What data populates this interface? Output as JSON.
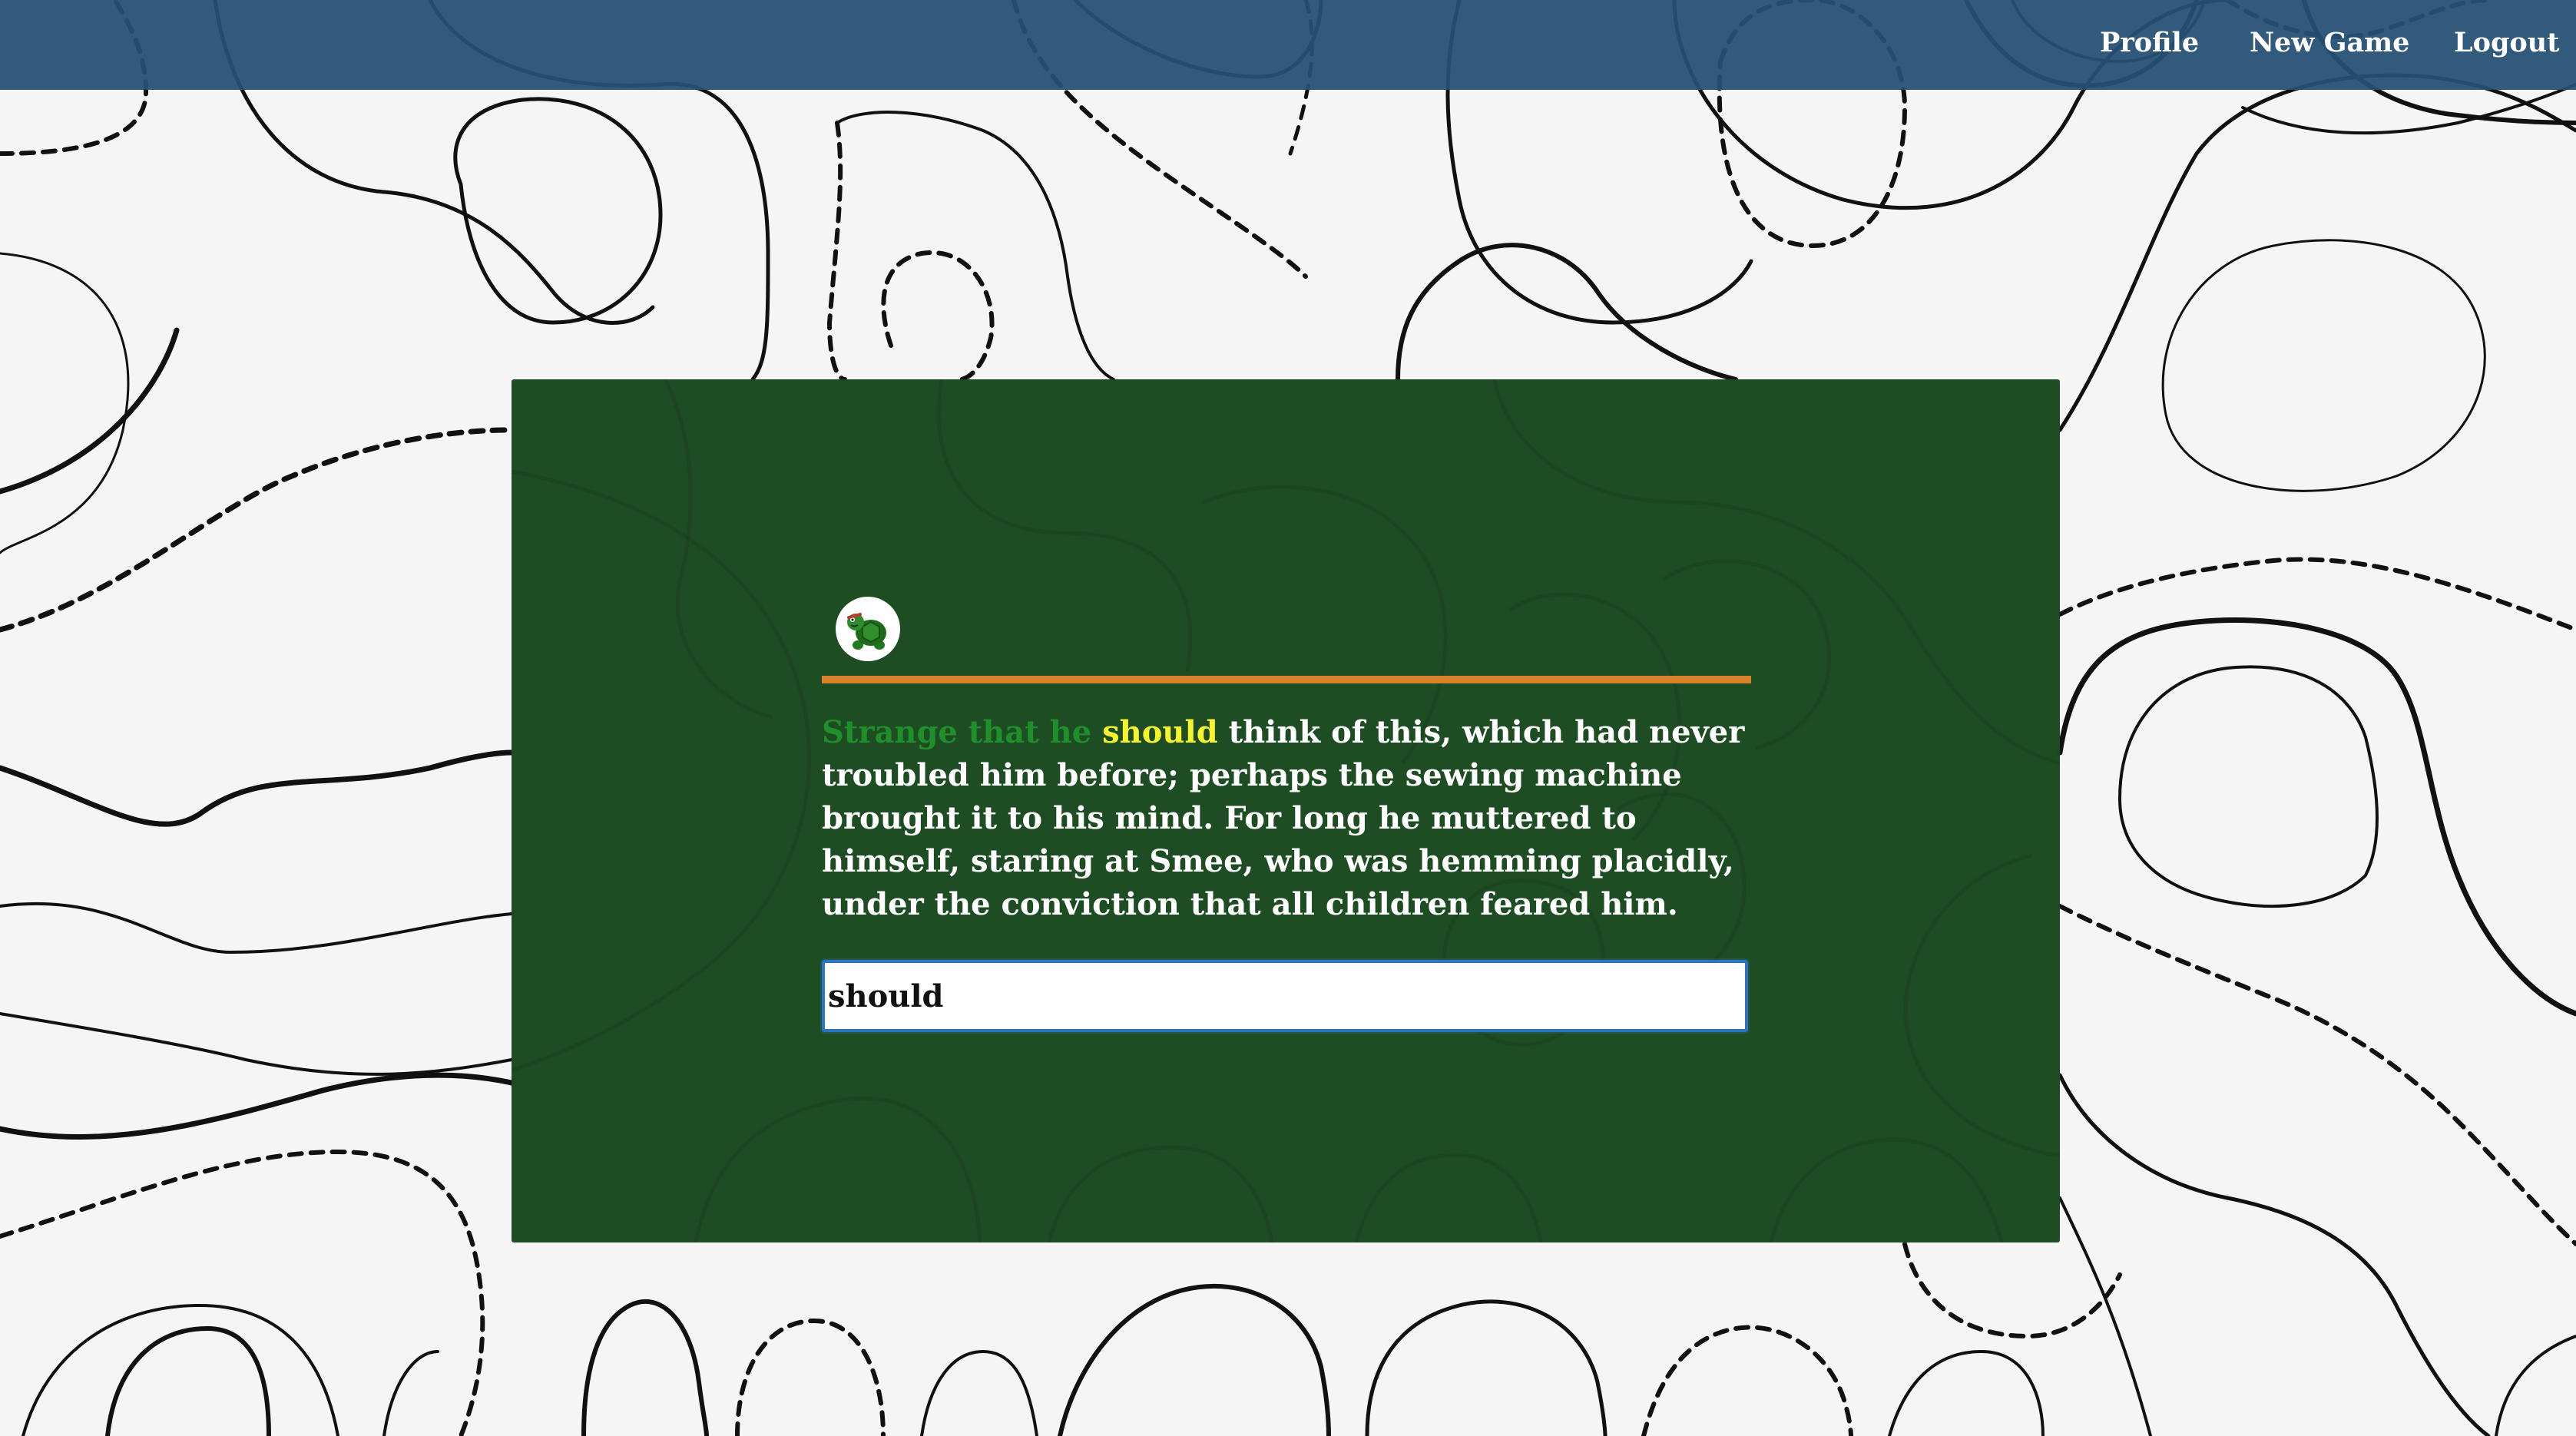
{
  "nav": {
    "profile_label": "Profile",
    "new_game_label": "New Game",
    "logout_label": "Logout"
  },
  "game": {
    "progress_fraction": 1.0,
    "passage": {
      "typed_text": "Strange that he",
      "current_word": "should",
      "remaining_text": "think of this, which had never troubled him before; perhaps the sewing machine brought it to his mind. For long he muttered to himself, staring at Smee, who was hemming placidly, under the conviction that all children feared him."
    },
    "input_value": "should",
    "avatar_icon": "turtle-icon"
  },
  "colors": {
    "navbar": "#255074",
    "panel": "#1b4a1f",
    "progress": "#d9822b",
    "typed_text": "#1e8f2a",
    "current_word": "#f6f52d",
    "input_border": "#2b74c2"
  }
}
